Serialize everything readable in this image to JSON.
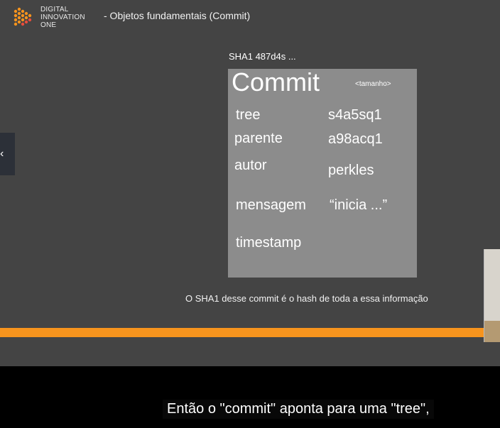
{
  "brand": {
    "line1": "DIGITAL",
    "line2": "INNOVATION",
    "line3": "ONE",
    "logo_icon": "hexagon-dots-play-logo",
    "logo_color": "#f7941d"
  },
  "slide": {
    "title": "- Objetos fundamentais (Commit)",
    "sha_label": "SHA1 487d4s ...",
    "commit_box": {
      "title": "Commit",
      "size_label": "<tamanho>",
      "fields": [
        {
          "key": "tree",
          "value": "s4a5sq1"
        },
        {
          "key": "parente",
          "value": "a98acq1"
        },
        {
          "key": "autor",
          "value": "perkles"
        },
        {
          "key": "mensagem",
          "value": "“inicia ...”"
        },
        {
          "key": "timestamp",
          "value": ""
        }
      ]
    },
    "caption": "O SHA1 desse commit é o hash de toda a essa informação",
    "accent_color": "#f7941d",
    "background_color": "#444444"
  },
  "player": {
    "prev_icon": "chevron-left-icon",
    "subtitle": "Então o \"commit\" aponta para uma \"tree\","
  }
}
